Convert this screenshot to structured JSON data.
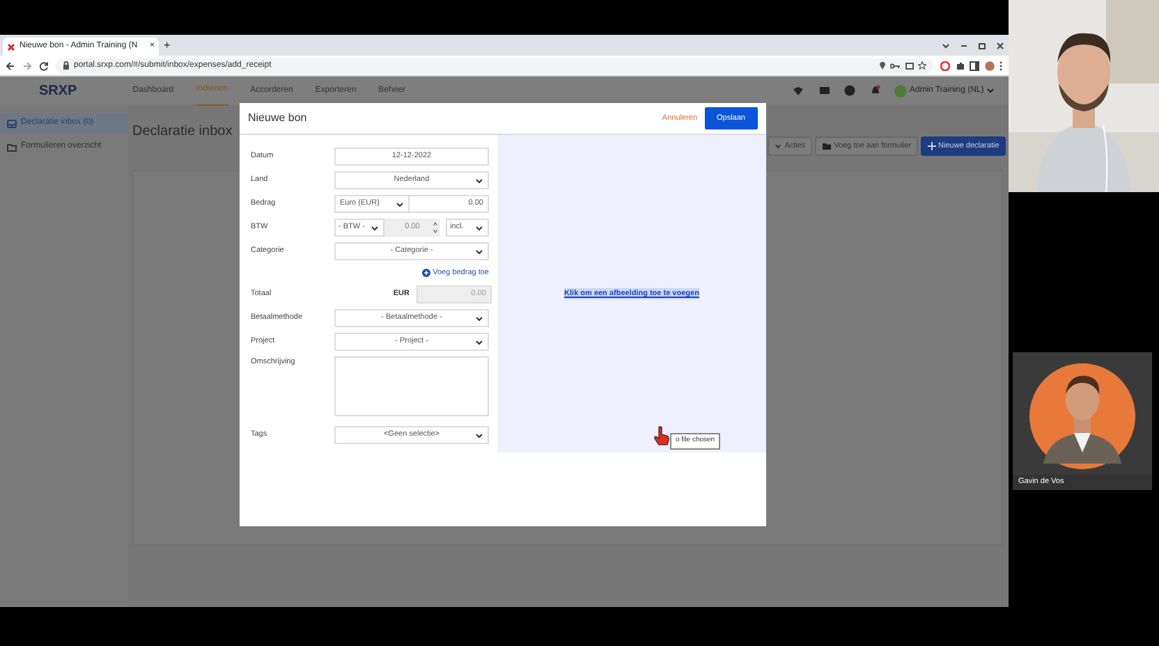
{
  "browser": {
    "tab_title": "Nieuwe bon - Admin Training (N",
    "tab_close": "×",
    "new_tab": "+",
    "url": "portal.srxp.com/#/submit/inbox/expenses/add_receipt"
  },
  "app": {
    "logo": "SRXP",
    "nav": [
      {
        "label": "Dashboard",
        "selected": false
      },
      {
        "label": "Indienen",
        "selected": true
      },
      {
        "label": "Accorderen",
        "selected": false
      },
      {
        "label": "Exporteren",
        "selected": false
      },
      {
        "label": "Beheer",
        "selected": false
      }
    ],
    "user": "Admin Training (NL)"
  },
  "sidebar": [
    {
      "label": "Declaratie inbox (0)",
      "selected": true
    },
    {
      "label": "Formulieren overzicht",
      "selected": false
    }
  ],
  "page": {
    "title": "Declaratie inbox",
    "actions": [
      "Acties",
      "Voeg toe aan formulier",
      "Nieuwe declaratie"
    ]
  },
  "modal": {
    "title": "Nieuwe bon",
    "cancel": "Annuleren",
    "save": "Opslaan",
    "fields": [
      {
        "kind": "date",
        "label": "Datum",
        "value": "12-12-2022"
      },
      {
        "kind": "select",
        "label": "Land",
        "value": "Nederland"
      },
      {
        "kind": "amount",
        "label": "Bedrag",
        "currency": "Euro (EUR)",
        "value": "0.00"
      },
      {
        "kind": "vat",
        "label": "BTW",
        "rate": "- BTW -",
        "value": "0.00",
        "unit": "incl."
      },
      {
        "kind": "select",
        "label": "Categorie",
        "value": "- Categorie -"
      },
      {
        "kind": "add",
        "label": "Voeg bedrag toe"
      },
      {
        "kind": "total",
        "label": "Totaal",
        "currency": "EUR",
        "value": "0.00"
      },
      {
        "kind": "select",
        "label": "Betaalmethode",
        "value": "- Betaalmethode -"
      },
      {
        "kind": "select",
        "label": "Project",
        "value": "- Project -"
      },
      {
        "kind": "textarea",
        "label": "Omschrijving"
      },
      {
        "kind": "select",
        "label": "Tags",
        "value": "<Geen selectie>"
      }
    ],
    "dropzone_link": "Klik om een afbeelding toe te voegen",
    "file_status": "o file chosen"
  },
  "participant": {
    "name": "Gavin de Vos"
  }
}
